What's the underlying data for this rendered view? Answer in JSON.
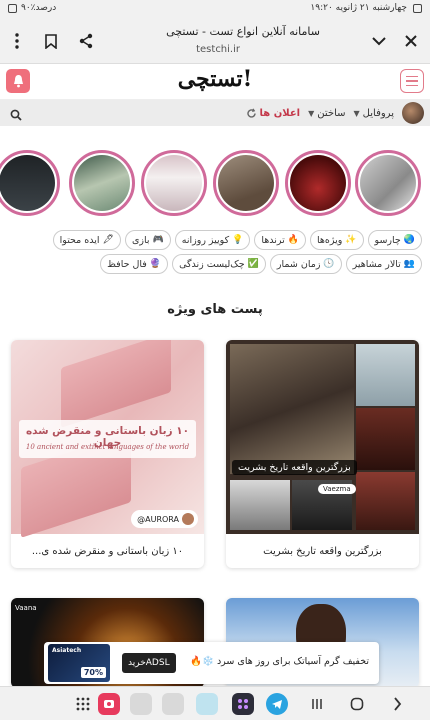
{
  "status_bar": {
    "datetime": "چهارشنبه ۲۱ ژانویه  ۱۹:۲۰",
    "battery": "۹۰٪درصد"
  },
  "browser": {
    "title": "سامانه آنلاین انواع تست - تستچی",
    "url": "testchi.ir"
  },
  "site": {
    "logo": "تستچی!"
  },
  "nav": {
    "profile": "پروفایل",
    "build": "ساختن",
    "announcements": "اعلان ها"
  },
  "chips": [
    {
      "label": "چارسو",
      "icon": "globe-icon"
    },
    {
      "label": "ویژه‌ها",
      "icon": "sparkle-icon"
    },
    {
      "label": "ترندها",
      "icon": "fire-icon"
    },
    {
      "label": "کوییز روزانه",
      "icon": "bulb-icon"
    },
    {
      "label": "بازی",
      "icon": "gamepad-icon"
    },
    {
      "label": "ایده محتوا",
      "icon": "pen-icon"
    },
    {
      "label": "تالار مشاهیر",
      "icon": "crowd-icon"
    },
    {
      "label": "زمان شمار",
      "icon": "clock-icon"
    },
    {
      "label": "چک‌لیست زندگی",
      "icon": "check-icon"
    },
    {
      "label": "فال حافظ",
      "icon": "crystal-ball-icon"
    }
  ],
  "section_title": "پست های ویژه",
  "posts": [
    {
      "caption": "بزرگترین واقعه تاریخ بشریت",
      "overlay": "بزرگترین واقعه تاریخ بشریت",
      "tag": "Vaezma"
    },
    {
      "caption": "۱۰ زبان باستانی و منقرض شده ی...",
      "overlay": "۱۰ زبان باستانی و منقرض شده جهان",
      "sub": "10 ancient and extinct languages of the world",
      "tag": "@AURORA"
    }
  ],
  "ad": {
    "text": "تخفیف گرم آسیاتک برای روز های سرد",
    "button": "خریدADSL",
    "thumb_label": "70%",
    "thumb_brand": "Asiatech"
  },
  "colors": {
    "accent": "#ef6f7c",
    "story_ring": "#d06a9a",
    "announce": "#c4384a"
  }
}
